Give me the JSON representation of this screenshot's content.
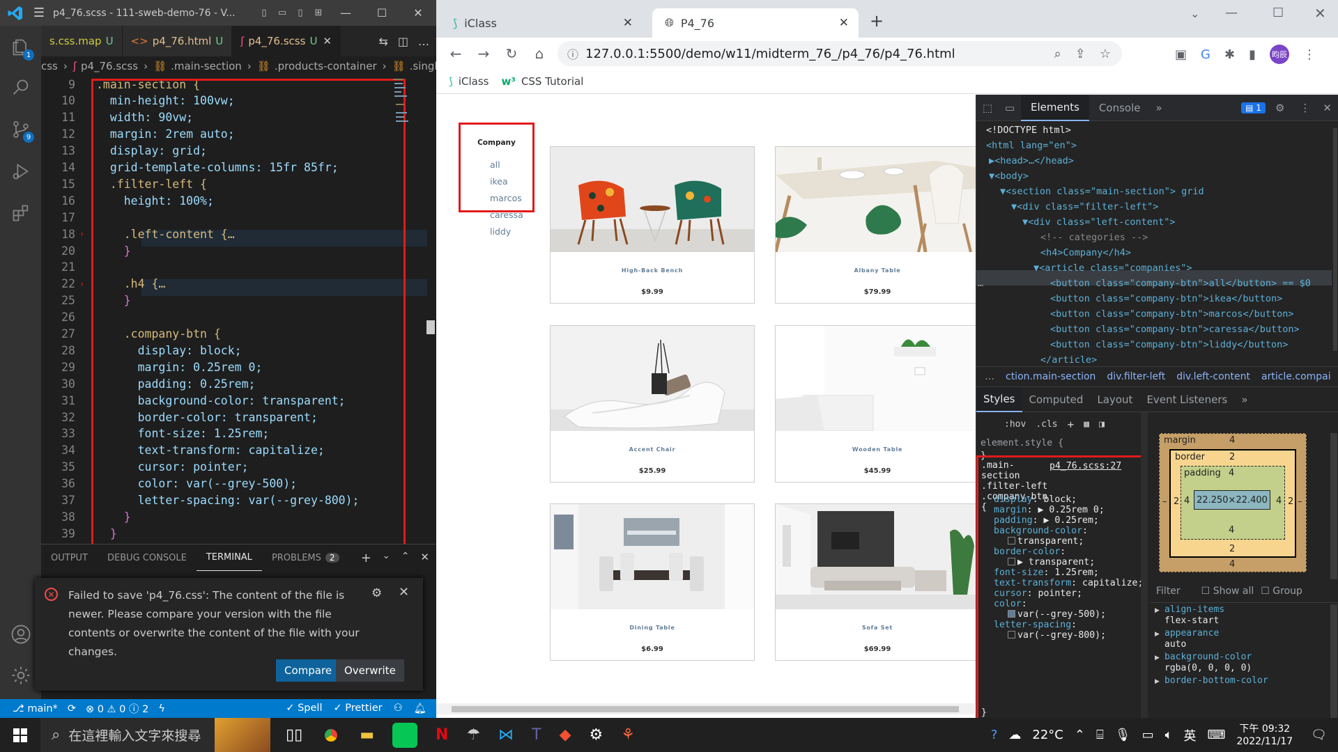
{
  "vscode": {
    "title": "p4_76.scss - 111-sweb-demo-76 - V...",
    "tabs": [
      {
        "label": "s.css.map",
        "status": "U"
      },
      {
        "label": "p4_76.html",
        "status": "U"
      },
      {
        "label": "p4_76.scss",
        "status": "U"
      }
    ],
    "breadcrumb": [
      "css",
      "p4_76.scss",
      ".main-section",
      ".products-container",
      ".single-"
    ],
    "code_lines": [
      {
        "n": "9",
        "text": ".main-section {"
      },
      {
        "n": "10",
        "text": "  min-height: 100vw;"
      },
      {
        "n": "11",
        "text": "  width: 90vw;"
      },
      {
        "n": "12",
        "text": "  margin: 2rem auto;"
      },
      {
        "n": "13",
        "text": "  display: grid;"
      },
      {
        "n": "14",
        "text": "  grid-template-columns: 15fr 85fr;"
      },
      {
        "n": "15",
        "text": "  .filter-left {"
      },
      {
        "n": "16",
        "text": "    height: 100%;"
      },
      {
        "n": "17",
        "text": ""
      },
      {
        "n": "18",
        "text": "    .left-content {…"
      },
      {
        "n": "20",
        "text": "    }"
      },
      {
        "n": "21",
        "text": ""
      },
      {
        "n": "22",
        "text": "    .h4 {…"
      },
      {
        "n": "25",
        "text": "    }"
      },
      {
        "n": "26",
        "text": ""
      },
      {
        "n": "27",
        "text": "    .company-btn {"
      },
      {
        "n": "28",
        "text": "      display: block;"
      },
      {
        "n": "29",
        "text": "      margin: 0.25rem 0;"
      },
      {
        "n": "30",
        "text": "      padding: 0.25rem;"
      },
      {
        "n": "31",
        "text": "      background-color: transparent;"
      },
      {
        "n": "32",
        "text": "      border-color: transparent;"
      },
      {
        "n": "33",
        "text": "      font-size: 1.25rem;"
      },
      {
        "n": "34",
        "text": "      text-transform: capitalize;"
      },
      {
        "n": "35",
        "text": "      cursor: pointer;"
      },
      {
        "n": "36",
        "text": "      color: var(--grey-500);"
      },
      {
        "n": "37",
        "text": "      letter-spacing: var(--grey-800);"
      },
      {
        "n": "38",
        "text": "    }"
      },
      {
        "n": "39",
        "text": "  }"
      }
    ],
    "panel_tabs": [
      {
        "label": "OUTPUT"
      },
      {
        "label": "DEBUG CONSOLE"
      },
      {
        "label": "TERMINAL"
      },
      {
        "label": "PROBLEMS",
        "badge": "2"
      }
    ],
    "notification": {
      "message": "Failed to save 'p4_76.css': The content of the file is newer. Please compare your version with the file contents or overwrite the content of the file with your changes.",
      "compare_label": "Compare",
      "overwrite_label": "Overwrite"
    },
    "status": {
      "branch": "main*",
      "problems": "⊗ 0 ⚠ 0 ⓘ 2",
      "spell": "✓ Spell",
      "prettier": "✓ Prettier"
    },
    "activity_badges": {
      "explorer": "1",
      "scm": "9"
    }
  },
  "chrome": {
    "tabs": [
      {
        "label": "iClass"
      },
      {
        "label": "P4_76"
      }
    ],
    "url": "127.0.0.1:5500/demo/w11/midterm_76_/p4_76/p4_76.html",
    "bookmarks": [
      {
        "label": "iClass"
      },
      {
        "label": "CSS Tutorial"
      }
    ],
    "profile": "昀辰"
  },
  "page": {
    "company_heading": "Company",
    "companies": [
      "all",
      "ikea",
      "marcos",
      "caressa",
      "liddy"
    ],
    "products": [
      {
        "name": "High-Back Bench",
        "price": "$9.99"
      },
      {
        "name": "Albany Table",
        "price": "$79.99"
      },
      {
        "name": "Accent Chair",
        "price": "$25.99"
      },
      {
        "name": "Wooden Table",
        "price": "$45.99"
      },
      {
        "name": "Dining Table",
        "price": "$6.99"
      },
      {
        "name": "Sofa Set",
        "price": "$69.99"
      }
    ]
  },
  "devtools": {
    "tabs": [
      "Elements",
      "Console"
    ],
    "issues_badge": "1",
    "dom_lines": [
      "<!DOCTYPE html>",
      "<html lang=\"en\">",
      "▶<head>…</head>",
      "▼<body>",
      "▼<section class=\"main-section\"> grid",
      "▼<div class=\"filter-left\">",
      "▼<div class=\"left-content\">",
      "<!-- categories -->",
      "<h4>Company</h4>",
      "▼<article class=\"companies\">",
      "<button class=\"company-btn\">all</button> == $0",
      "<button class=\"company-btn\">ikea</button>",
      "<button class=\"company-btn\">marcos</button>",
      "<button class=\"company-btn\">caressa</button>",
      "<button class=\"company-btn\">liddy</button>",
      "</article>"
    ],
    "crumbs": [
      "…",
      "ction.main-section",
      "div.filter-left",
      "div.left-content",
      "article.compai",
      "…"
    ],
    "sub_tabs": [
      "Styles",
      "Computed",
      "Layout",
      "Event Listeners"
    ],
    "filter_tools": [
      ":hov",
      ".cls",
      "+"
    ],
    "element_style": "element.style {",
    "rule": {
      "selector": ".main-section .filter-left .company-btn {",
      "source": "p4_76.scss:27",
      "decls": [
        {
          "p": "display",
          "v": "block;"
        },
        {
          "p": "margin",
          "v": "▶ 0.25rem 0;"
        },
        {
          "p": "padding",
          "v": "▶ 0.25rem;"
        },
        {
          "p": "background-color",
          "v": "transparent;"
        },
        {
          "p": "border-color",
          "v": "▶ transparent;"
        },
        {
          "p": "font-size",
          "v": "1.25rem;"
        },
        {
          "p": "text-transform",
          "v": "capitalize;"
        },
        {
          "p": "cursor",
          "v": "pointer;"
        },
        {
          "p": "color",
          "v": "var(--grey-500);"
        },
        {
          "p": "letter-spacing",
          "v": "var(--grey-800);"
        }
      ]
    },
    "box_model": {
      "margin_label": "margin",
      "margin": "4",
      "border_label": "border",
      "border": "2",
      "padding_label": "padding",
      "padding": "4",
      "content": "22.250×22.400",
      "side_left": "2",
      "side_right": "2",
      "pad_left": "4",
      "pad_right": "4",
      "pad_bottom": "4",
      "border_bottom": "2",
      "margin_bottom": "4",
      "dash": "–"
    },
    "computed_filter": {
      "placeholder": "Filter",
      "show_all": "Show all",
      "group": "Group"
    },
    "computed": [
      {
        "p": "align-items",
        "v": "flex-start"
      },
      {
        "p": "appearance",
        "v": "auto"
      },
      {
        "p": "background-color",
        "v": "rgba(0, 0, 0, 0)"
      },
      {
        "p": "border-bottom-color",
        "v": ""
      }
    ]
  },
  "taskbar": {
    "search_placeholder": "在這裡輸入文字來搜尋",
    "temperature": "22°C",
    "ime": "英",
    "time": "下午 09:32",
    "date": "2022/11/17"
  },
  "colors": {
    "vscode_bg": "#1e1e1e",
    "status_bar": "#007acc",
    "highlight_red": "#e21b1b",
    "compare_btn": "#0e639c"
  }
}
